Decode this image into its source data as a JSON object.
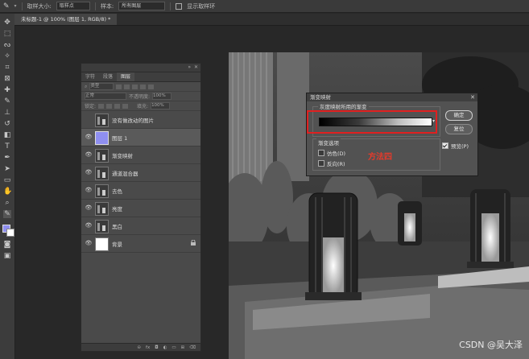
{
  "options_bar": {
    "size_label": "取样大小:",
    "size_value": "取样点",
    "sample_label": "样本:",
    "sample_value": "所有图层",
    "show_ring": "显示取样环"
  },
  "document_tab": "未标题-1 @ 100% (图层 1, RGB/8) *",
  "layers_panel": {
    "tabs": [
      "字符",
      "段落",
      "图层"
    ],
    "active_tab": "图层",
    "filter_value": "类型",
    "blend_mode": "正常",
    "opacity_label": "不透明度:",
    "opacity_value": "100%",
    "lock_label": "锁定:",
    "fill_label": "填充:",
    "fill_value": "100%",
    "layers": [
      {
        "name": "没有做改动的图片",
        "visible": false,
        "thumb": "photo"
      },
      {
        "name": "图层 1",
        "visible": true,
        "thumb": "blue",
        "selected": true
      },
      {
        "name": "渐变映射",
        "visible": true,
        "thumb": "photo"
      },
      {
        "name": "通道混合器",
        "visible": true,
        "thumb": "photo"
      },
      {
        "name": "去色",
        "visible": true,
        "thumb": "photo"
      },
      {
        "name": "亮度",
        "visible": true,
        "thumb": "photo"
      },
      {
        "name": "黑白",
        "visible": true,
        "thumb": "photo"
      },
      {
        "name": "背景",
        "visible": true,
        "thumb": "white",
        "locked": true
      }
    ],
    "footer_icons": [
      "link-icon",
      "fx-icon",
      "mask-icon",
      "adjustment-icon",
      "folder-icon",
      "new-layer-icon",
      "trash-icon"
    ]
  },
  "dialog": {
    "title": "渐变映射",
    "group_label": "灰度映射所用的渐变",
    "options_label": "渐变选项",
    "dither_label": "仿色(D)",
    "reverse_label": "反向(R)",
    "ok_label": "确定",
    "reset_label": "复位",
    "preview_label": "预览(P)"
  },
  "annotation": "方法四",
  "watermark": "CSDN @吴大泽",
  "colors": {
    "highlight": "#e02020",
    "annotation": "#e83a2a"
  }
}
